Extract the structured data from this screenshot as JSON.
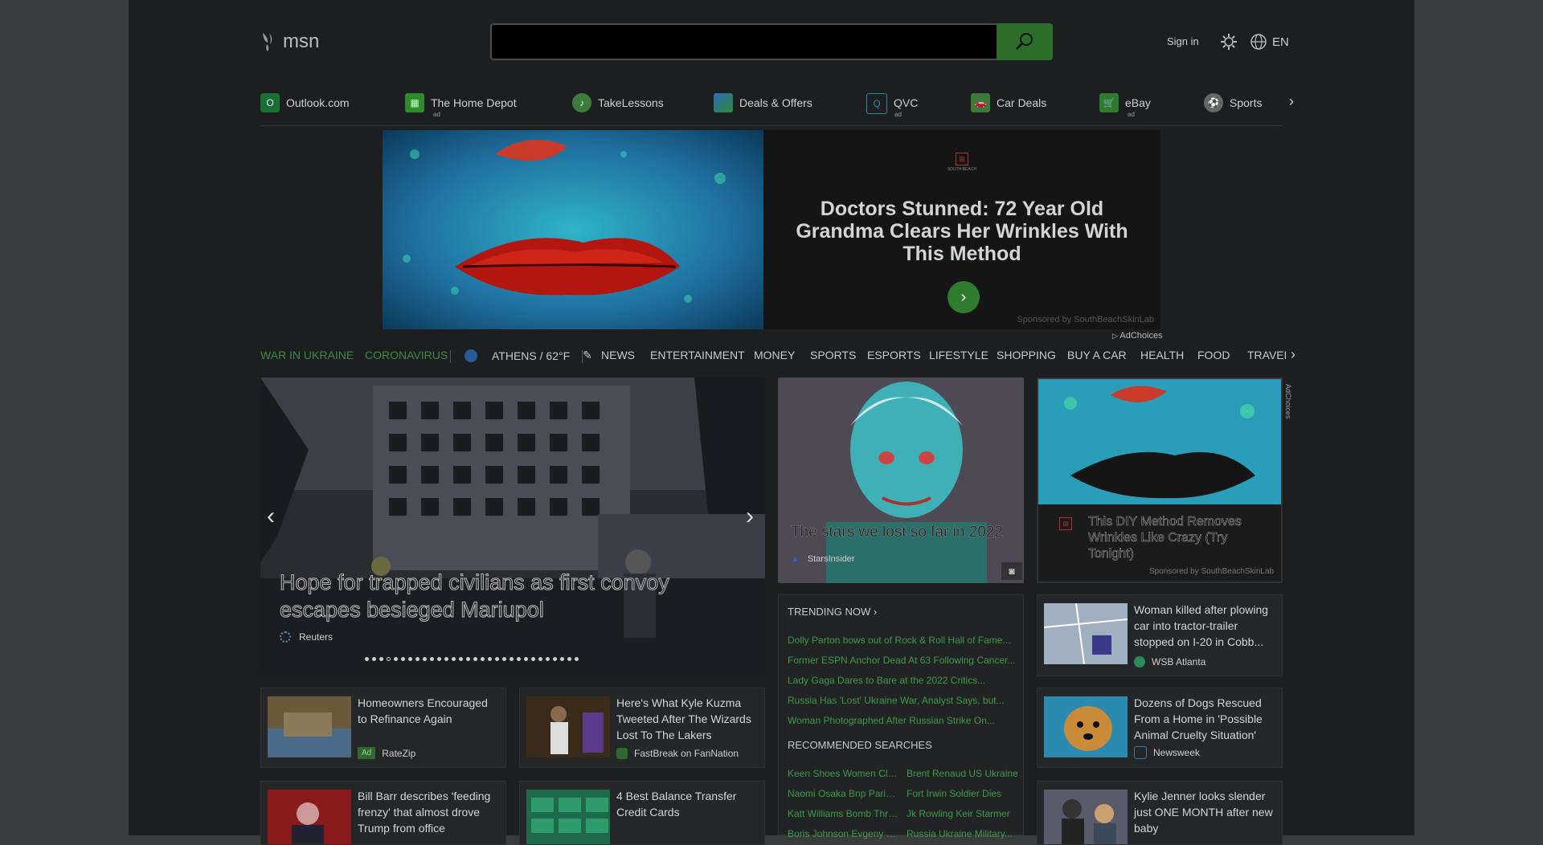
{
  "header": {
    "logo_text": "msn",
    "search": {
      "value": "",
      "placeholder": ""
    },
    "sign_in": "Sign in",
    "language": "EN"
  },
  "quick_links": [
    {
      "label": "Outlook.com",
      "ad": "",
      "icon": "outlook-icon",
      "color": "#1a7d3f"
    },
    {
      "label": "The Home Depot",
      "ad": "ad",
      "icon": "home-depot-icon",
      "color": "#2d8a2d"
    },
    {
      "label": "TakeLessons",
      "ad": "",
      "icon": "takelessons-icon",
      "color": "#4a9a4a"
    },
    {
      "label": "Deals & Offers",
      "ad": "",
      "icon": "deals-icon",
      "color": "#2b6bb5"
    },
    {
      "label": "QVC",
      "ad": "ad",
      "icon": "qvc-icon",
      "color": "#2a8aa0"
    },
    {
      "label": "Car Deals",
      "ad": "",
      "icon": "car-icon",
      "color": "#3a8a3a"
    },
    {
      "label": "eBay",
      "ad": "ad",
      "icon": "ebay-icon",
      "color": "#3a9a3a"
    },
    {
      "label": "Sports",
      "ad": "",
      "icon": "sports-icon",
      "color": "#888888"
    }
  ],
  "ad_banner": {
    "headline": "Doctors Stunned: 72 Year Old Grandma Clears Her Wrinkles With This Method",
    "logo_text": "SOUTH BEACH",
    "sponsored": "Sponsored by SouthBeachSkinLab",
    "adchoices": "AdChoices"
  },
  "categories": {
    "war": "WAR IN UKRAINE",
    "corona": "CORONAVIRUS",
    "weather": "ATHENS / 62°F",
    "items": [
      "NEWS",
      "ENTERTAINMENT",
      "MONEY",
      "SPORTS",
      "ESPORTS",
      "LIFESTYLE",
      "SHOPPING",
      "BUY A CAR",
      "HEALTH",
      "FOOD",
      "TRAVEL"
    ]
  },
  "hero": {
    "title": "Hope for trapped civilians as first convoy escapes besieged Mariupol",
    "source": "Reuters",
    "dot_count": 30
  },
  "star_card": {
    "title": "The stars we lost so far in 2022",
    "source": "StarsInsider"
  },
  "ad_card": {
    "title": "This DIY Method Removes Wrinkles Like Crazy (Try Tonight)",
    "sponsored": "Sponsored by SouthBeachSkinLab",
    "vertical": "AdChoices"
  },
  "trending": {
    "heading": "TRENDING NOW ›",
    "items": [
      "Dolly Parton bows out of Rock & Roll Hall of Fame...",
      "Former ESPN Anchor Dead At 63 Following Cancer...",
      "Lady Gaga Dares to Bare at the 2022 Critics...",
      "Russia Has 'Lost' Ukraine War, Analyst Says, but...",
      "Woman Photographed After Russian Strike On..."
    ],
    "recommended_heading": "RECOMMENDED SEARCHES",
    "recommended": [
      [
        "Keen Shoes Women Clea...",
        "Brent Renaud US Ukraine"
      ],
      [
        "Naomi Osaka Bnp Pariba...",
        "Fort Irwin Soldier Dies"
      ],
      [
        "Katt Williams Bomb Threat",
        "Jk Rowling Keir Starmer"
      ],
      [
        "Boris Johnson Evgeny Le...",
        "Russia Ukraine Military..."
      ]
    ]
  },
  "cards": {
    "refinance": {
      "title": "Homeowners Encouraged to Refinance Again",
      "badge": "Ad",
      "source": "RateZip"
    },
    "kuzma": {
      "title": "Here's What Kyle Kuzma Tweeted After The Wizards Lost To The Lakers",
      "source": "FastBreak on FanNation"
    },
    "barr": {
      "title": "Bill Barr describes 'feeding frenzy' that almost drove Trump from office"
    },
    "credit": {
      "title": "4 Best Balance Transfer Credit Cards"
    },
    "woman_killed": {
      "title": "Woman killed after plowing car into tractor-trailer stopped on I-20 in Cobb...",
      "source": "WSB Atlanta"
    },
    "dogs": {
      "title": "Dozens of Dogs Rescued From a Home in 'Possible Animal Cruelty Situation'",
      "source": "Newsweek"
    },
    "kylie": {
      "title": "Kylie Jenner looks slender just ONE MONTH after new baby"
    }
  }
}
